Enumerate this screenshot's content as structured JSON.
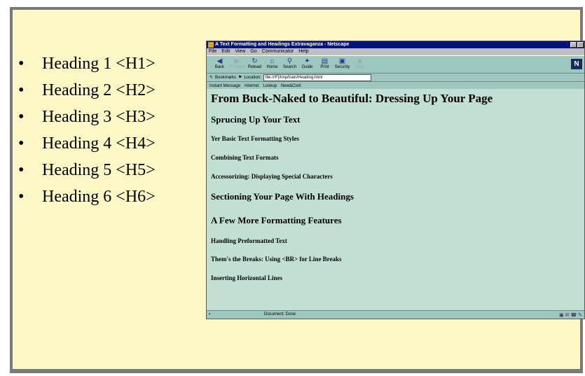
{
  "bullets": [
    "Heading 1 <H1>",
    "Heading 2 <H2>",
    "Heading 3 <H3>",
    "Heading 4 <H4>",
    "Heading 5 <H5>",
    "Heading 6 <H6>"
  ],
  "bullet_char": "•",
  "browser": {
    "title": "A Text Formatting and Headings Extravaganza - Netscape",
    "menu": [
      "File",
      "Edit",
      "View",
      "Go",
      "Communicator",
      "Help"
    ],
    "toolbar": [
      "Back",
      "Forward",
      "Reload",
      "Home",
      "Search",
      "Guide",
      "Print",
      "Security",
      "Stop"
    ],
    "bookmarks_label": "Bookmarks",
    "location_label": "Location:",
    "location_value": "file:///F|/tmp/train/Heading.html",
    "personal": [
      "Instant Message",
      "Internet",
      "Lookup",
      "New&Cool"
    ],
    "status": "Document: Done",
    "logo": "N"
  },
  "page": {
    "headings": [
      {
        "level": 1,
        "text": "From Buck-Naked to Beautiful: Dressing Up Your Page"
      },
      {
        "level": 2,
        "text": "Sprucing Up Your Text"
      },
      {
        "level": 3,
        "text": "Yer Basic Text Formatting Styles"
      },
      {
        "level": 3,
        "text": "Combining Text Formats"
      },
      {
        "level": 3,
        "text": "Accessorizing: Displaying Special Characters"
      },
      {
        "level": 2,
        "text": "Sectioning Your Page With Headings"
      },
      {
        "level": 2,
        "text": "A Few More Formatting Features"
      },
      {
        "level": 3,
        "text": "Handling Preformatted Text"
      },
      {
        "level": 3,
        "text": "Them's the Breaks: Using <BR> for Line Breaks"
      },
      {
        "level": 3,
        "text": "Inserting Horizontal Lines"
      }
    ]
  },
  "colors": {
    "slide_bg": "#fdf8c6",
    "browser_content": "#c2dfd4",
    "titlebar": "#00127b"
  }
}
